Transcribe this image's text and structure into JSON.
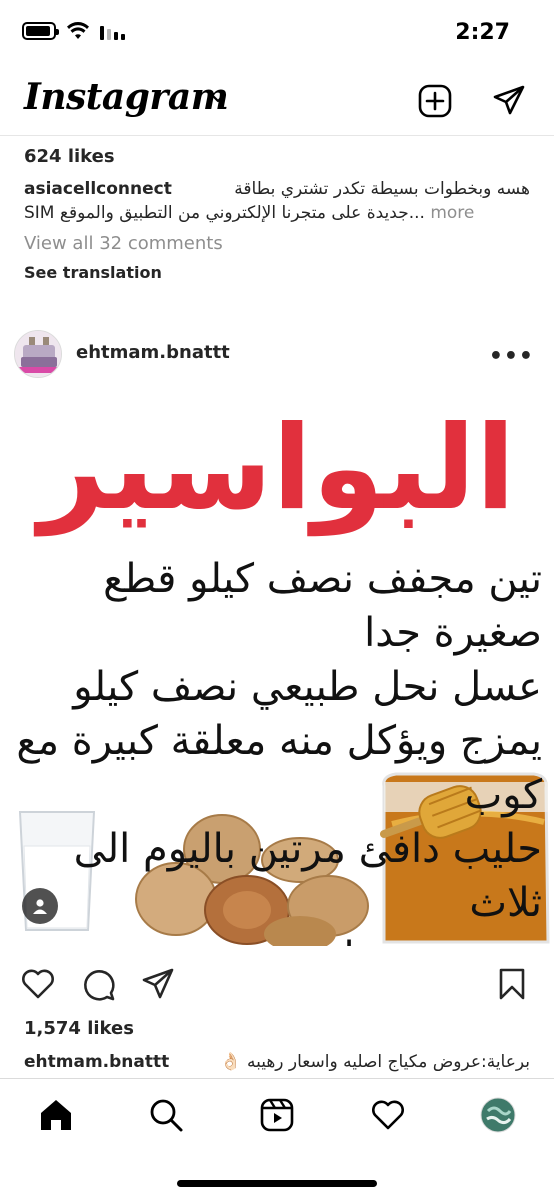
{
  "status_bar": {
    "time": "2:27"
  },
  "header": {
    "logo": "Instagram"
  },
  "previous_post": {
    "likes": "624 likes",
    "username": "asiacellconnect",
    "caption_line1": "هسه وبخطوات بسيطة تكدر تشتري بطاقة",
    "caption_line2": "SIM جديدة على متجرنا الإلكتروني من التطبيق والموقع...",
    "more": "more",
    "view_comments": "View all 32 comments",
    "see_translation": "See translation"
  },
  "post": {
    "username": "ehtmam.bnattt",
    "options": "•••",
    "image_title": "البواسير",
    "image_lines": [
      "تين مجفف نصف كيلو قطع صغيرة جدا",
      "عسل نحل طبيعي نصف كيلو",
      "يمزج ويؤكل منه معلقة كبيرة مع كوب",
      "حليب دافئ مرتين باليوم الى ثلاث",
      "مرات"
    ],
    "likes": "1,574 likes",
    "caption_user": "ehtmam.bnattt",
    "caption_text": "برعاية:عروض مكياج اصليه واسعار رهيبه 👌🏻"
  },
  "colors": {
    "title_red": "#e1303d",
    "text": "#262626",
    "muted": "#8e8e8e"
  },
  "icons": [
    "chevron-down-icon",
    "new-post-icon",
    "direct-message-icon",
    "more-options-icon",
    "user-tag-icon",
    "heart-icon",
    "comment-icon",
    "share-icon",
    "bookmark-icon",
    "home-icon",
    "search-icon",
    "reels-icon",
    "activity-icon",
    "profile-avatar"
  ]
}
